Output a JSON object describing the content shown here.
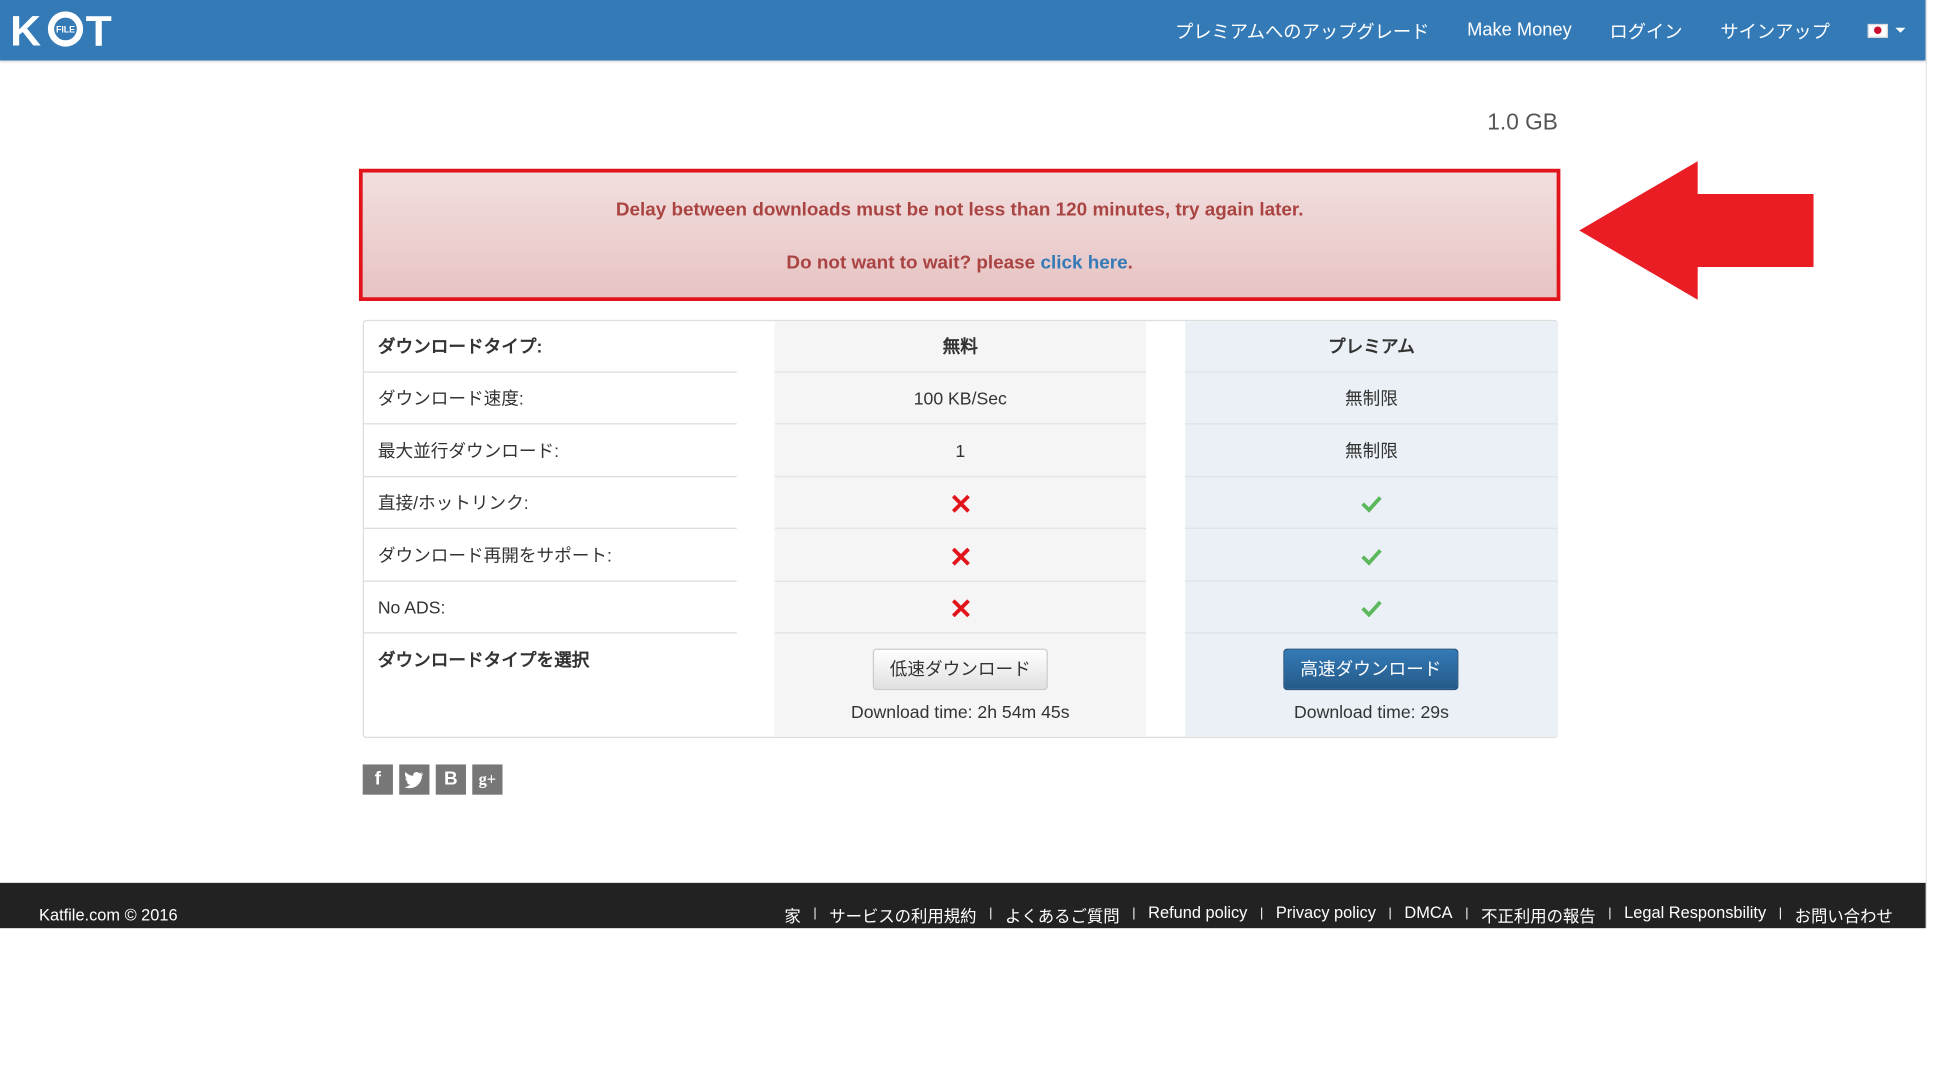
{
  "brand": {
    "logo_text_left": "K",
    "logo_text_right": "T",
    "logo_badge": "FILE"
  },
  "nav": {
    "links": [
      "プレミアムへのアップグレード",
      "Make Money",
      "ログイン",
      "サインアップ"
    ],
    "language": "Japanese flag"
  },
  "file": {
    "size": "1.0 GB"
  },
  "alert": {
    "message": "Delay between downloads must be not less than 120 minutes, try again later.",
    "prompt": "Do not want to wait? please ",
    "link_text": "click here",
    "suffix": "."
  },
  "table": {
    "header": {
      "label": "ダウンロードタイプ:",
      "free": "無料",
      "premium": "プレミアム"
    },
    "rows": [
      {
        "label": "ダウンロード速度:",
        "free": "100 KB/Sec",
        "premium": "無制限"
      },
      {
        "label": "最大並行ダウンロード:",
        "free": "1",
        "premium": "無制限"
      },
      {
        "label": "直接/ホットリンク:",
        "free_icon": "cross-icon",
        "premium_icon": "check-icon"
      },
      {
        "label": "ダウンロード再開をサポート:",
        "free_icon": "cross-icon",
        "premium_icon": "check-icon"
      },
      {
        "label": "No ADS:",
        "free_icon": "cross-icon",
        "premium_icon": "check-icon"
      }
    ],
    "select_label": "ダウンロードタイプを選択",
    "free_button": "低速ダウンロード",
    "premium_button": "高速ダウンロード",
    "free_time": "Download time: 2h 54m 45s",
    "premium_time": "Download time: 29s"
  },
  "share": [
    "f",
    "B",
    "g+"
  ],
  "footer": {
    "copyright": "Katfile.com © 2016",
    "links": [
      "家",
      "サービスの利用規約",
      "よくあるご質問",
      "Refund policy",
      "Privacy policy",
      "DMCA",
      "不正利用の報告",
      "Legal Responsbility",
      "お問い合わせ"
    ]
  },
  "colors": {
    "nav": "#337ab7",
    "alert_border": "#e2141b",
    "alert_text": "#a94442",
    "cross": "#e2141b",
    "check": "#5cb85c",
    "footer": "#222222"
  }
}
